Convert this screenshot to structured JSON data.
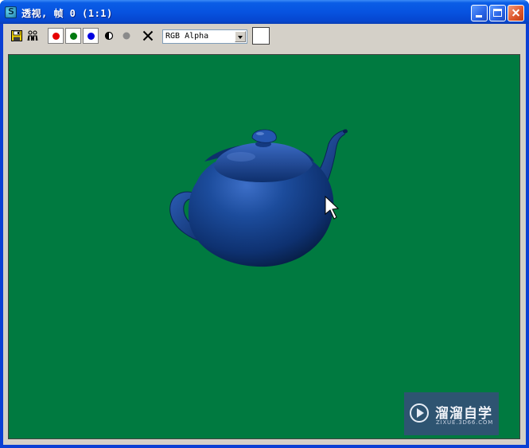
{
  "window": {
    "title": "透视, 帧 0 (1:1)",
    "titlebar_color": "#0753e0",
    "controls": {
      "minimize": "minimize-icon",
      "maximize": "maximize-icon",
      "close": "close-icon"
    }
  },
  "toolbar": {
    "icons": [
      "save-icon",
      "clone-icon",
      "alpha-icon",
      "mono-icon",
      "clear-icon"
    ],
    "color_channels": [
      {
        "name": "red-channel",
        "color": "#e60000"
      },
      {
        "name": "green-channel",
        "color": "#007a10"
      },
      {
        "name": "blue-channel",
        "color": "#0000e0"
      }
    ],
    "channel_select": {
      "value": "RGB Alpha"
    },
    "swatch_color": "#ffffff"
  },
  "viewport": {
    "background_color": "#007a40",
    "object": "teapot",
    "object_color": "#123e8a"
  },
  "watermark": {
    "brand": "溜溜自学",
    "url": "ZIXUE.3D66.COM"
  }
}
